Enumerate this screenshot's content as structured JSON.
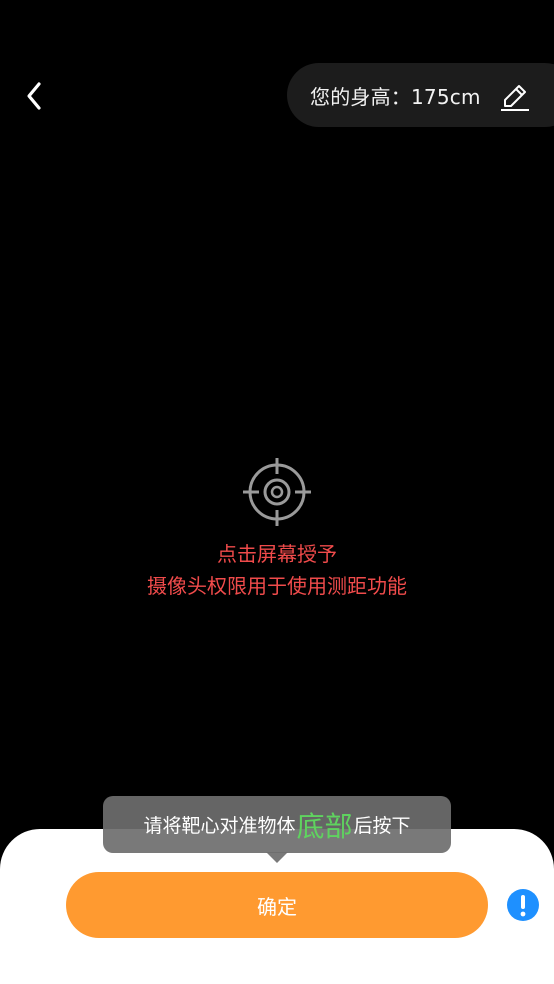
{
  "header": {
    "back_icon": "chevron-left-icon",
    "height_label": "您的身高：175cm",
    "edit_icon": "pencil-icon"
  },
  "camera_prompt": {
    "icon": "crosshair-target-icon",
    "line1": "点击屏幕授予",
    "line2": "摄像头权限用于使用测距功能",
    "color": "#f04b4b"
  },
  "tooltip": {
    "text_before": "请将靶心对准物体",
    "text_emphasis": "底部",
    "text_after": "后按下",
    "emphasis_color": "#5fd35f"
  },
  "bottom_bar": {
    "confirm_label": "确定",
    "confirm_color": "#ff9a30",
    "info_icon": "exclamation-info-icon",
    "info_color": "#1e90ff"
  }
}
